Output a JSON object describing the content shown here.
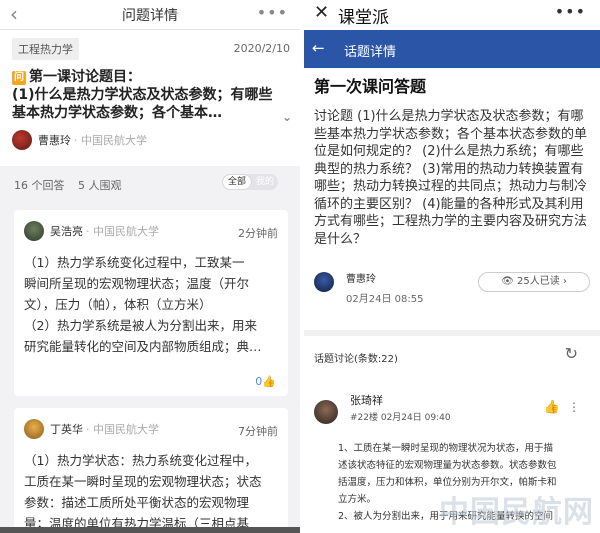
{
  "left": {
    "header": {
      "title": "问题详情",
      "back_icon": "chevron-left-icon",
      "more_icon": "more-dots-icon"
    },
    "topic": {
      "tag": "工程热力学",
      "date": "2020/2/10",
      "badge": "问",
      "title_lines": [
        "第一课讨论题目：",
        "(1)什么是热力学状态及状态参数；有哪些",
        "基本热力学状态参数；各个基本…"
      ],
      "author": "曹惠玲",
      "school": "· 中国民航大学"
    },
    "stats": {
      "answers": "16 个回答",
      "views": "5 人围观",
      "toggle_all": "全部",
      "toggle_mine": "我的"
    },
    "answers": [
      {
        "name": "吴浩亮",
        "school": "· 中国民航大学",
        "time": "2分钟前",
        "lines": [
          "（1）热力学系统变化过程中，工致某一",
          "瞬间所呈现的宏观物理状态；温度（开尔",
          "文），压力（帕），体积（立方米）",
          "（2）热力学系统是被人为分割出来，用来",
          "研究能量转化的空间及内部物质组成；典…"
        ],
        "likes": "0"
      },
      {
        "name": "丁英华",
        "school": "· 中国民航大学",
        "time": "7分钟前",
        "lines": [
          "（1）热力学状态：热力系统变化过程中，",
          "工质在某一瞬时呈现的宏观物理状态；状态",
          "参数：描述工质所处平衡状态的宏观物理",
          "量；温度的单位有热力学温标（三相点基"
        ]
      }
    ]
  },
  "right": {
    "top": {
      "app": "课堂派",
      "close_icon": "close-icon",
      "more_icon": "more-dots-icon"
    },
    "bar": {
      "title": "话题详情",
      "back_icon": "arrow-left-icon"
    },
    "question": {
      "title": "第一次课问答题",
      "desc": "讨论题 (1)什么是热力学状态及状态参数；有哪些基本热力学状态参数；各个基本状态参数的单位是如何规定的？ (2)什么是热力系统；有哪些典型的热力系统？ (3)常用的热动力转换装置有哪些；热动力转换过程的共同点；热动力与制冷循环的主要区别？ (4)能量的各种形式及其利用方式有哪些；工程热力学的主要内容及研究方法是什么？"
    },
    "author": {
      "name": "曹惠玲",
      "date": "02月24日 08:55",
      "read": "25人已读"
    },
    "discussion": {
      "label": "话题讨论(条数:22)"
    },
    "comment": {
      "name": "张琦祥",
      "meta": "#22楼 02月24日 09:40",
      "lines": [
        "1、工质在某一瞬时呈现的物理状况为状态，用于描",
        "述该状态特征的宏观物理量为状态参数。状态参数包",
        "括温度，压力和体积，单位分别为开尔文，帕斯卡和",
        "立方米。",
        "2、被人为分割出来，用于用来研究能量转换的空间"
      ]
    },
    "watermark": "中国民航网"
  }
}
